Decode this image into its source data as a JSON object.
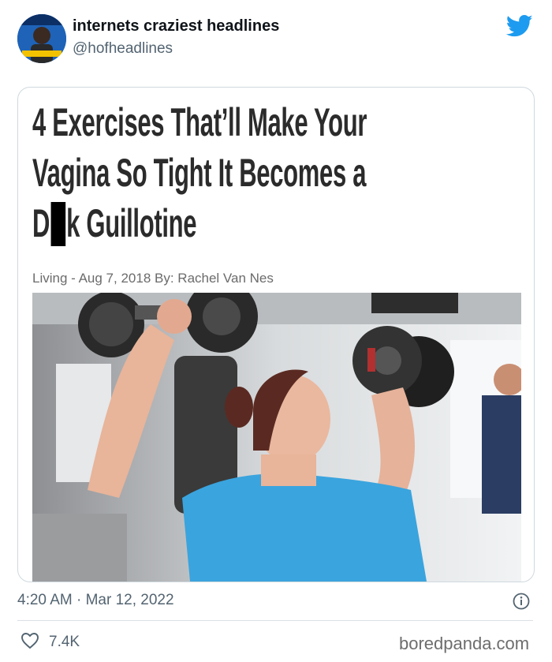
{
  "tweet": {
    "display_name": "internets craziest headlines",
    "handle": "@hofheadlines",
    "timestamp": "4:20 AM · Mar 12, 2022",
    "likes": "7.4K",
    "twitter_brand_color": "#1d9bf0"
  },
  "article": {
    "headline_line1": "4 Exercises That’ll Make Your",
    "headline_line2": "Vagina So Tight It Becomes a",
    "headline_line3_start": "D",
    "headline_line3_end": "k Guillotine",
    "byline": "Living - Aug 7, 2018 By: Rachel Van Nes"
  },
  "watermark": "boredpanda.com"
}
